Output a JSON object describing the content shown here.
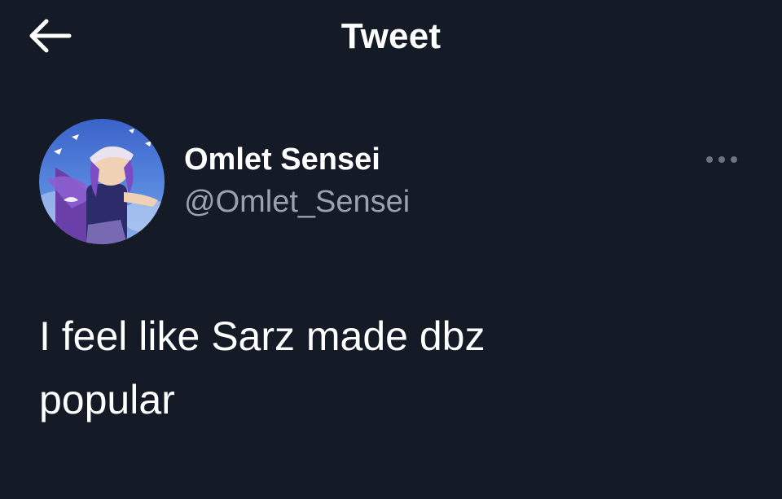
{
  "header": {
    "title": "Tweet",
    "back_icon": "arrow-left-icon"
  },
  "tweet": {
    "author": {
      "display_name": "Omlet Sensei",
      "handle": "@Omlet_Sensei",
      "avatar_icon": "anime-character-avatar"
    },
    "more_icon": "more-horizontal-icon",
    "text": "I feel like Sarz made dbz\npopular"
  },
  "colors": {
    "background": "#151b26",
    "primary_text": "#ffffff",
    "secondary_text": "#9aa3ad",
    "icon_muted": "#6b7480"
  }
}
